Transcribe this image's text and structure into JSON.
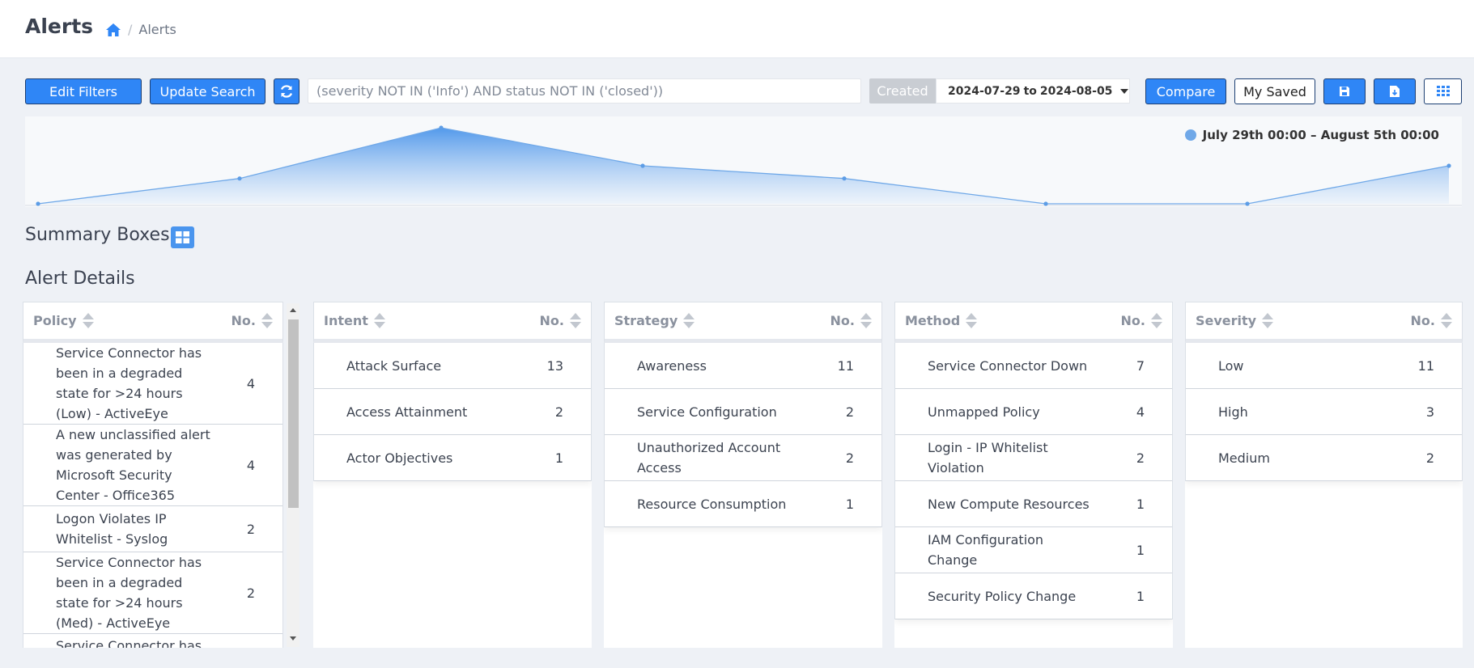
{
  "header": {
    "title": "Alerts",
    "breadcrumb": {
      "home_icon": "home-icon",
      "separator": "/",
      "current": "Alerts"
    }
  },
  "toolbar": {
    "edit_filters": "Edit Filters",
    "update_search": "Update Search",
    "refresh_icon": "refresh-icon",
    "query": "(severity NOT IN ('Info') AND status NOT IN ('closed'))",
    "created_label": "Created",
    "date_from": "2024-07-29",
    "date_to_word": "to",
    "date_to": "2024-08-05",
    "compare": "Compare",
    "my_saved": "My Saved",
    "save_icon": "save-icon",
    "export_icon": "export-icon",
    "grid_icon": "grid-icon"
  },
  "colors": {
    "accent": "#2f86f6",
    "button_border": "#1c3f73",
    "chart_line": "#6fa8e8"
  },
  "chart_data": {
    "type": "area",
    "series": [
      {
        "name": "July 29th 00:00 – August 5th 00:00",
        "values": [
          0,
          6,
          18,
          9,
          6,
          0,
          0,
          9
        ]
      }
    ],
    "x": [
      0,
      1,
      2,
      3,
      4,
      5,
      6,
      7
    ],
    "xlabel": "",
    "ylabel": "",
    "grid": false,
    "legend": "top-right"
  },
  "sections": {
    "summary_title": "Summary Boxes",
    "summary_icon": "grid-icon",
    "details_title": "Alert Details"
  },
  "tables": {
    "policy": {
      "header": "Policy",
      "count_header": "No.",
      "rows": [
        {
          "label": "Service Connector has been in a degraded state for >24 hours (Low) - ActiveEye",
          "value": "4"
        },
        {
          "label": "A new unclassified alert was generated by Microsoft Security Center - Office365",
          "value": "4"
        },
        {
          "label": "Logon Violates IP Whitelist - Syslog",
          "value": "2"
        },
        {
          "label": "Service Connector has been in a degraded state for >24 hours (Med) - ActiveEye",
          "value": "2"
        },
        {
          "label": "Service Connector has",
          "value": ""
        }
      ]
    },
    "intent": {
      "header": "Intent",
      "count_header": "No.",
      "rows": [
        {
          "label": "Attack Surface",
          "value": "13"
        },
        {
          "label": "Access Attainment",
          "value": "2"
        },
        {
          "label": "Actor Objectives",
          "value": "1"
        }
      ]
    },
    "strategy": {
      "header": "Strategy",
      "count_header": "No.",
      "rows": [
        {
          "label": "Awareness",
          "value": "11"
        },
        {
          "label": "Service Configuration",
          "value": "2"
        },
        {
          "label": "Unauthorized Account Access",
          "value": "2"
        },
        {
          "label": "Resource Consumption",
          "value": "1"
        }
      ]
    },
    "method": {
      "header": "Method",
      "count_header": "No.",
      "rows": [
        {
          "label": "Service Connector Down",
          "value": "7"
        },
        {
          "label": "Unmapped Policy",
          "value": "4"
        },
        {
          "label": "Login - IP Whitelist Violation",
          "value": "2"
        },
        {
          "label": "New Compute Resources",
          "value": "1"
        },
        {
          "label": "IAM Configuration Change",
          "value": "1"
        },
        {
          "label": "Security Policy Change",
          "value": "1"
        }
      ]
    },
    "severity": {
      "header": "Severity",
      "count_header": "No.",
      "rows": [
        {
          "label": "Low",
          "value": "11"
        },
        {
          "label": "High",
          "value": "3"
        },
        {
          "label": "Medium",
          "value": "2"
        }
      ]
    }
  }
}
